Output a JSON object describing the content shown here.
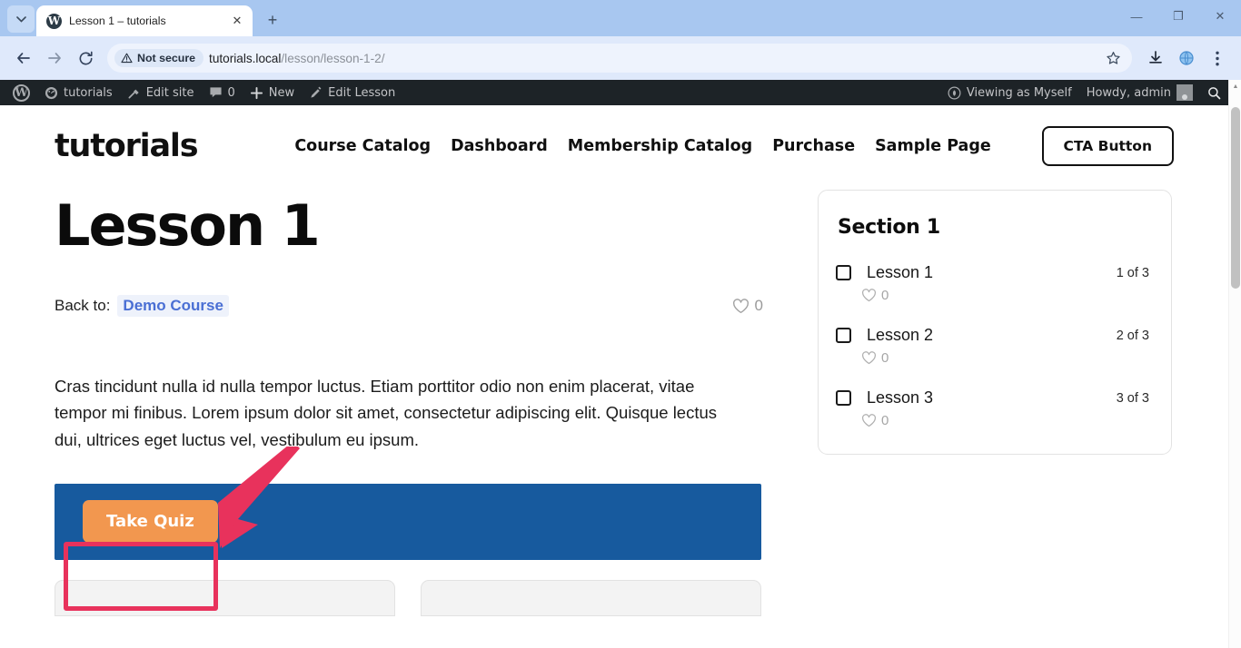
{
  "browser": {
    "tab": {
      "title": "Lesson 1 – tutorials",
      "favicon": "wordpress-favicon"
    },
    "new_tab_label": "+",
    "tab_list_icon": "chevron-down-icon",
    "window_controls": {
      "minimize": "—",
      "maximize": "❐",
      "close": "✕"
    },
    "nav": {
      "back": "←",
      "forward": "→",
      "reload": "⟳"
    },
    "omnibox": {
      "security_label": "Not secure",
      "security_icon": "warning-triangle-icon",
      "url_host": "tutorials.local",
      "url_path": "/lesson/lesson-1-2/",
      "star_icon": "bookmark-star-icon"
    },
    "toolbar_icons": [
      "download-icon",
      "extension-globe-icon",
      "three-dot-menu-icon"
    ]
  },
  "adminbar": {
    "wp_logo": "wordpress-logo-icon",
    "items": [
      {
        "label": "tutorials",
        "icon": "dashboard-icon"
      },
      {
        "label": "Edit site",
        "icon": "hammer-icon"
      },
      {
        "label": "0",
        "icon": "comment-bubble-icon"
      },
      {
        "label": "New",
        "icon": "plus-icon"
      },
      {
        "label": "Edit Lesson",
        "icon": "pencil-icon"
      }
    ],
    "viewing_as": "Viewing as Myself",
    "viewing_as_icon": "eye-globe-icon",
    "howdy": "Howdy, admin",
    "avatar": "user-avatar",
    "search_icon": "search-icon"
  },
  "site": {
    "logo": "tutorials",
    "nav": [
      {
        "label": "Course Catalog"
      },
      {
        "label": "Dashboard"
      },
      {
        "label": "Membership Catalog"
      },
      {
        "label": "Purchase"
      },
      {
        "label": "Sample Page"
      }
    ],
    "cta_label": "CTA Button"
  },
  "lesson": {
    "title": "Lesson 1",
    "back_to_label": "Back to:",
    "course_label": "Demo Course",
    "like_count": "0",
    "like_icon": "heart-outline-icon",
    "body": "Cras tincidunt nulla id nulla tempor luctus. Etiam porttitor odio non enim placerat, vitae tempor mi finibus. Lorem ipsum dolor sit amet, consectetur adipiscing elit. Quisque lectus dui, ultrices eget luctus vel, vestibulum eu ipsum.",
    "quiz_button_label": "Take Quiz"
  },
  "sidebar": {
    "section_title": "Section 1",
    "lessons": [
      {
        "name": "Lesson 1",
        "position": "1 of 3",
        "likes": "0"
      },
      {
        "name": "Lesson 2",
        "position": "2 of 3",
        "likes": "0"
      },
      {
        "name": "Lesson 3",
        "position": "3 of 3",
        "likes": "0"
      }
    ]
  },
  "colors": {
    "quiz_panel": "#175a9e",
    "quiz_button": "#f2974f",
    "annotation": "#e8325c",
    "course_link": "#4a6fd4",
    "adminbar": "#1d2327"
  }
}
